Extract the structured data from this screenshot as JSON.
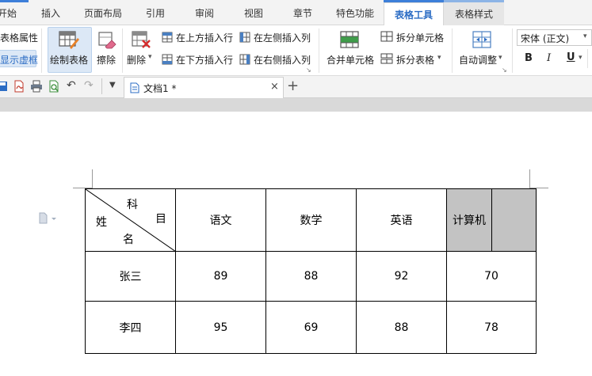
{
  "menu": {
    "tabs": [
      "开始",
      "插入",
      "页面布局",
      "引用",
      "审阅",
      "视图",
      "章节",
      "特色功能",
      "表格工具",
      "表格样式"
    ],
    "active": "表格工具"
  },
  "ribbon": {
    "table_props": "表格属性",
    "show_gridlines": "显示虚框",
    "draw_table": "绘制表格",
    "erase": "擦除",
    "delete": "删除",
    "insert_row_above": "在上方插入行",
    "insert_row_below": "在下方插入行",
    "insert_col_left": "在左侧插入列",
    "insert_col_right": "在右侧插入列",
    "merge_cells": "合并单元格",
    "split_cells": "拆分单元格",
    "split_table": "拆分表格",
    "auto_fit": "自动调整",
    "font_name": "宋体 (正文)",
    "bold": "B",
    "italic": "I",
    "underline": "U"
  },
  "document_tab": {
    "name": "文档1 *"
  },
  "table": {
    "header": {
      "diag_top": "科",
      "diag_right": "目",
      "diag_left": "姓",
      "diag_bottom": "名",
      "subjects": [
        "语文",
        "数学",
        "英语",
        "计算机"
      ]
    },
    "rows": [
      {
        "name": "张三",
        "scores": [
          "89",
          "88",
          "92",
          "70"
        ]
      },
      {
        "name": "李四",
        "scores": [
          "95",
          "69",
          "88",
          "78"
        ]
      }
    ]
  },
  "colors": {
    "accent": "#2b6cc4",
    "selected_cell": "#c3c3c3"
  }
}
